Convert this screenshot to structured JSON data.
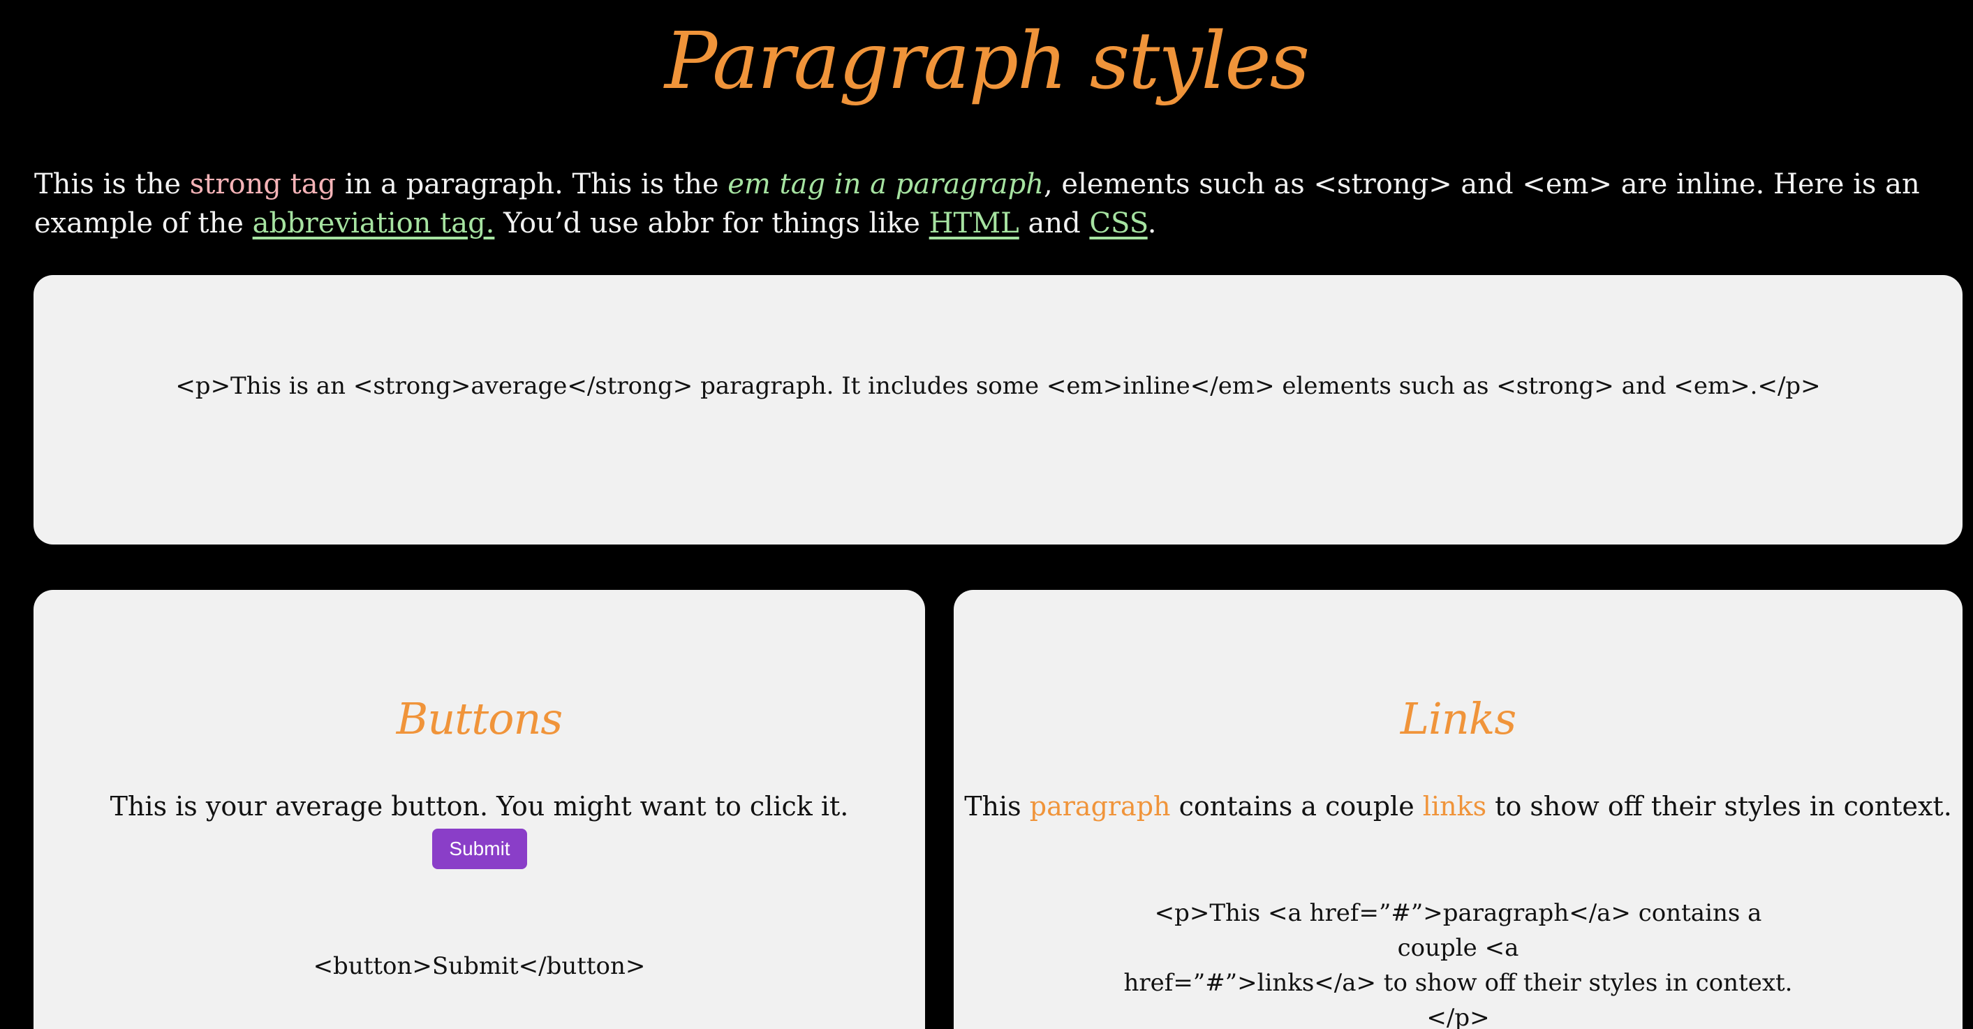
{
  "page": {
    "title": "Paragraph styles"
  },
  "intro": {
    "text_1": "This is the ",
    "strong_text": "strong tag",
    "text_2": " in a paragraph. This is the ",
    "em_text": "em tag in a paragraph",
    "text_3": ", elements such as <strong> and <em> are inline. Here is an example of the ",
    "abbr_text": "abbreviation tag.",
    "text_4": " You’d use abbr for things like ",
    "html_abbr": "HTML",
    "text_5": " and ",
    "css_abbr": "CSS",
    "text_6": "."
  },
  "paragraph_card": {
    "code": "<p>This is an <strong>average</strong> paragraph. It includes some <em>inline</em> elements such as <strong> and <em>.</p>"
  },
  "buttons_card": {
    "heading": "Buttons",
    "text": "This is your average button. You might want to click it.",
    "button_label": "Submit",
    "code": "<button>Submit</button>"
  },
  "links_card": {
    "heading": "Links",
    "text_1": "This ",
    "link_1": "paragraph",
    "text_2": " contains a couple ",
    "link_2": "links",
    "text_3": " to show off their styles in context.",
    "code_line_1": "<p>This <a href=”#”>paragraph</a> contains a couple <a",
    "code_line_2": "href=”#”>links</a> to show off their styles in context.</p>"
  },
  "colors": {
    "background": "#000000",
    "card": "#f1f1f1",
    "accent_orange": "#f0943a",
    "strong_pink": "#f5b3b7",
    "em_green": "#a6e3a1",
    "button_purple": "#8a3ec8"
  }
}
